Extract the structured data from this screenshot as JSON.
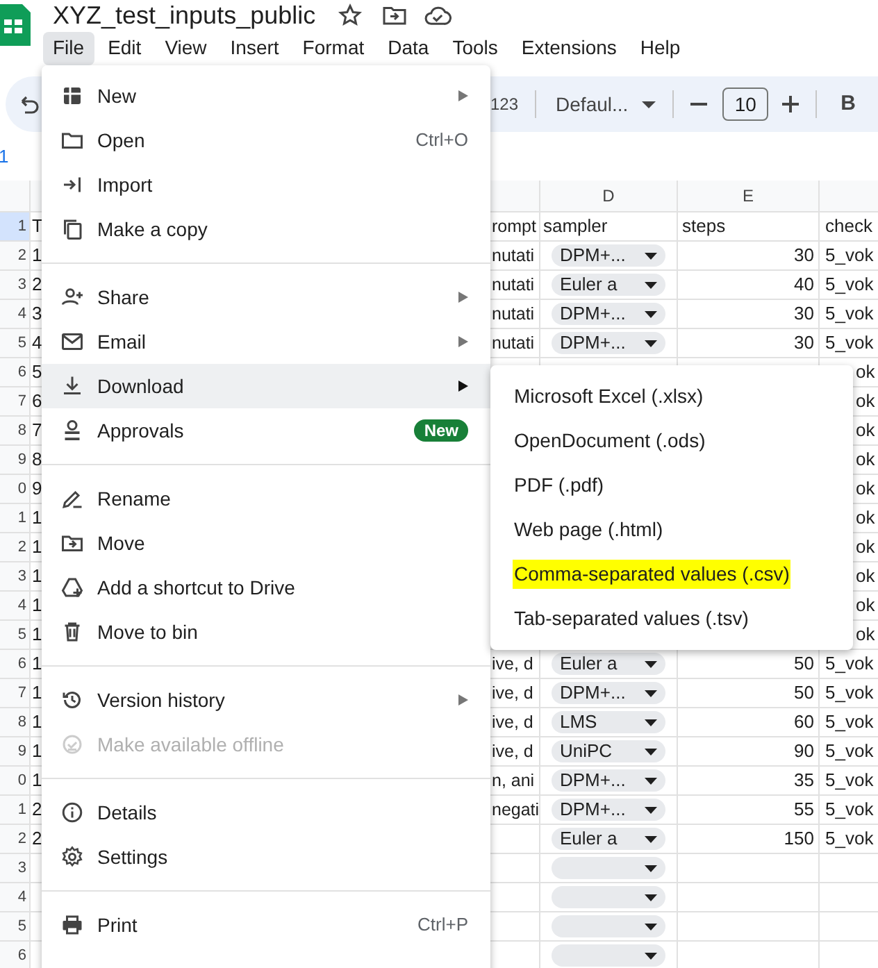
{
  "app": {
    "title": "XYZ_test_inputs_public"
  },
  "menu_bar": [
    {
      "label": "File",
      "selected": true
    },
    {
      "label": "Edit",
      "selected": false
    },
    {
      "label": "View",
      "selected": false
    },
    {
      "label": "Insert",
      "selected": false
    },
    {
      "label": "Format",
      "selected": false
    },
    {
      "label": "Data",
      "selected": false
    },
    {
      "label": "Tools",
      "selected": false
    },
    {
      "label": "Extensions",
      "selected": false
    },
    {
      "label": "Help",
      "selected": false
    }
  ],
  "toolbar": {
    "number_format": "123",
    "font": "Defaul...",
    "font_size": "10",
    "bold": "B"
  },
  "formula_bar": {
    "text": "1"
  },
  "grid": {
    "column_headers": [
      "D",
      "E"
    ],
    "rows": [
      {
        "label": "1",
        "selected": true,
        "kind": "header",
        "col_a": "T",
        "col_c": "rompt",
        "sampler": "sampler",
        "steps": "steps",
        "col_f": "check"
      },
      {
        "label": "2",
        "selected": false,
        "kind": "data",
        "col_a": "1",
        "col_c": "nutati",
        "sampler": "DPM+...",
        "steps": "30",
        "col_f": "5_vok"
      },
      {
        "label": "3",
        "selected": false,
        "kind": "data",
        "col_a": "2",
        "col_c": "nutati",
        "sampler": "Euler a",
        "steps": "40",
        "col_f": "5_vok"
      },
      {
        "label": "4",
        "selected": false,
        "kind": "data",
        "col_a": "3",
        "col_c": "nutati",
        "sampler": "DPM+...",
        "steps": "30",
        "col_f": "5_vok"
      },
      {
        "label": "5",
        "selected": false,
        "kind": "data",
        "col_a": "4",
        "col_c": "nutati",
        "sampler": "DPM+...",
        "steps": "30",
        "col_f": "5_vok"
      },
      {
        "label": "6",
        "selected": false,
        "kind": "covered",
        "col_a": "5",
        "col_f": "ok"
      },
      {
        "label": "7",
        "selected": false,
        "kind": "covered",
        "col_a": "6",
        "col_f": "ok"
      },
      {
        "label": "8",
        "selected": false,
        "kind": "covered",
        "col_a": "7",
        "col_f": "ok"
      },
      {
        "label": "9",
        "selected": false,
        "kind": "covered",
        "col_a": "8",
        "col_f": "ok"
      },
      {
        "label": "0",
        "selected": false,
        "kind": "covered",
        "col_a": "9",
        "col_f": "ok"
      },
      {
        "label": "1",
        "selected": false,
        "kind": "covered",
        "col_a": "1",
        "col_f": "ok"
      },
      {
        "label": "2",
        "selected": false,
        "kind": "covered",
        "col_a": "1",
        "col_f": "ok"
      },
      {
        "label": "3",
        "selected": false,
        "kind": "covered",
        "col_a": "1",
        "col_f": "ok"
      },
      {
        "label": "4",
        "selected": false,
        "kind": "covered",
        "col_a": "1",
        "col_f": "ok"
      },
      {
        "label": "5",
        "selected": false,
        "kind": "covered",
        "col_a": "1",
        "col_f": "ok"
      },
      {
        "label": "6",
        "selected": false,
        "kind": "data",
        "col_a": "1",
        "col_c": "ive, d",
        "sampler": "Euler a",
        "steps": "50",
        "col_f": "5_vok"
      },
      {
        "label": "7",
        "selected": false,
        "kind": "data",
        "col_a": "1",
        "col_c": "ive, d",
        "sampler": "DPM+...",
        "steps": "50",
        "col_f": "5_vok"
      },
      {
        "label": "8",
        "selected": false,
        "kind": "data",
        "col_a": "1",
        "col_c": "ive, d",
        "sampler": "LMS",
        "steps": "60",
        "col_f": "5_vok"
      },
      {
        "label": "9",
        "selected": false,
        "kind": "data",
        "col_a": "1",
        "col_c": "ive, d",
        "sampler": "UniPC",
        "steps": "90",
        "col_f": "5_vok"
      },
      {
        "label": "0",
        "selected": false,
        "kind": "data",
        "col_a": "1",
        "col_c": "n, ani",
        "sampler": "DPM+...",
        "steps": "35",
        "col_f": "5_vok"
      },
      {
        "label": "1",
        "selected": false,
        "kind": "data",
        "col_a": "2",
        "col_c": "negati",
        "sampler": "DPM+...",
        "steps": "55",
        "col_f": "5_vok"
      },
      {
        "label": "2",
        "selected": false,
        "kind": "data",
        "col_a": "2",
        "sampler": "Euler a",
        "steps": "150",
        "col_f": "5_vok"
      },
      {
        "label": "3",
        "selected": false,
        "kind": "data"
      },
      {
        "label": "4",
        "selected": false,
        "kind": "data"
      },
      {
        "label": "5",
        "selected": false,
        "kind": "data"
      },
      {
        "label": "6",
        "selected": false,
        "kind": "data"
      }
    ]
  },
  "file_menu": {
    "groups": [
      [
        {
          "label": "New",
          "submenu": true,
          "selected": false,
          "disabled": false
        },
        {
          "label": "Open",
          "shortcut": "Ctrl+O",
          "submenu": false,
          "selected": false,
          "disabled": false
        },
        {
          "label": "Import",
          "submenu": false,
          "selected": false,
          "disabled": false
        },
        {
          "label": "Make a copy",
          "submenu": false,
          "selected": false,
          "disabled": false
        }
      ],
      [
        {
          "label": "Share",
          "submenu": true,
          "selected": false,
          "disabled": false
        },
        {
          "label": "Email",
          "submenu": true,
          "selected": false,
          "disabled": false
        },
        {
          "label": "Download",
          "submenu": true,
          "selected": true,
          "disabled": false
        },
        {
          "label": "Approvals",
          "badge": "New",
          "submenu": false,
          "selected": false,
          "disabled": false
        }
      ],
      [
        {
          "label": "Rename",
          "submenu": false,
          "selected": false,
          "disabled": false
        },
        {
          "label": "Move",
          "submenu": false,
          "selected": false,
          "disabled": false
        },
        {
          "label": "Add a shortcut to Drive",
          "submenu": false,
          "selected": false,
          "disabled": false
        },
        {
          "label": "Move to bin",
          "submenu": false,
          "selected": false,
          "disabled": false
        }
      ],
      [
        {
          "label": "Version history",
          "submenu": true,
          "selected": false,
          "disabled": false
        },
        {
          "label": "Make available offline",
          "submenu": false,
          "selected": false,
          "disabled": true
        }
      ],
      [
        {
          "label": "Details",
          "submenu": false,
          "selected": false,
          "disabled": false
        },
        {
          "label": "Settings",
          "submenu": false,
          "selected": false,
          "disabled": false
        }
      ],
      [
        {
          "label": "Print",
          "shortcut": "Ctrl+P",
          "submenu": false,
          "selected": false,
          "disabled": false
        }
      ]
    ]
  },
  "download_submenu": {
    "items": [
      {
        "label": "Microsoft Excel (.xlsx)",
        "highlighted": false
      },
      {
        "label": "OpenDocument (.ods)",
        "highlighted": false
      },
      {
        "label": "PDF (.pdf)",
        "highlighted": false
      },
      {
        "label": "Web page (.html)",
        "highlighted": false
      },
      {
        "label": "Comma-separated values (.csv)",
        "highlighted": true
      },
      {
        "label": "Tab-separated values (.tsv)",
        "highlighted": false
      }
    ]
  }
}
